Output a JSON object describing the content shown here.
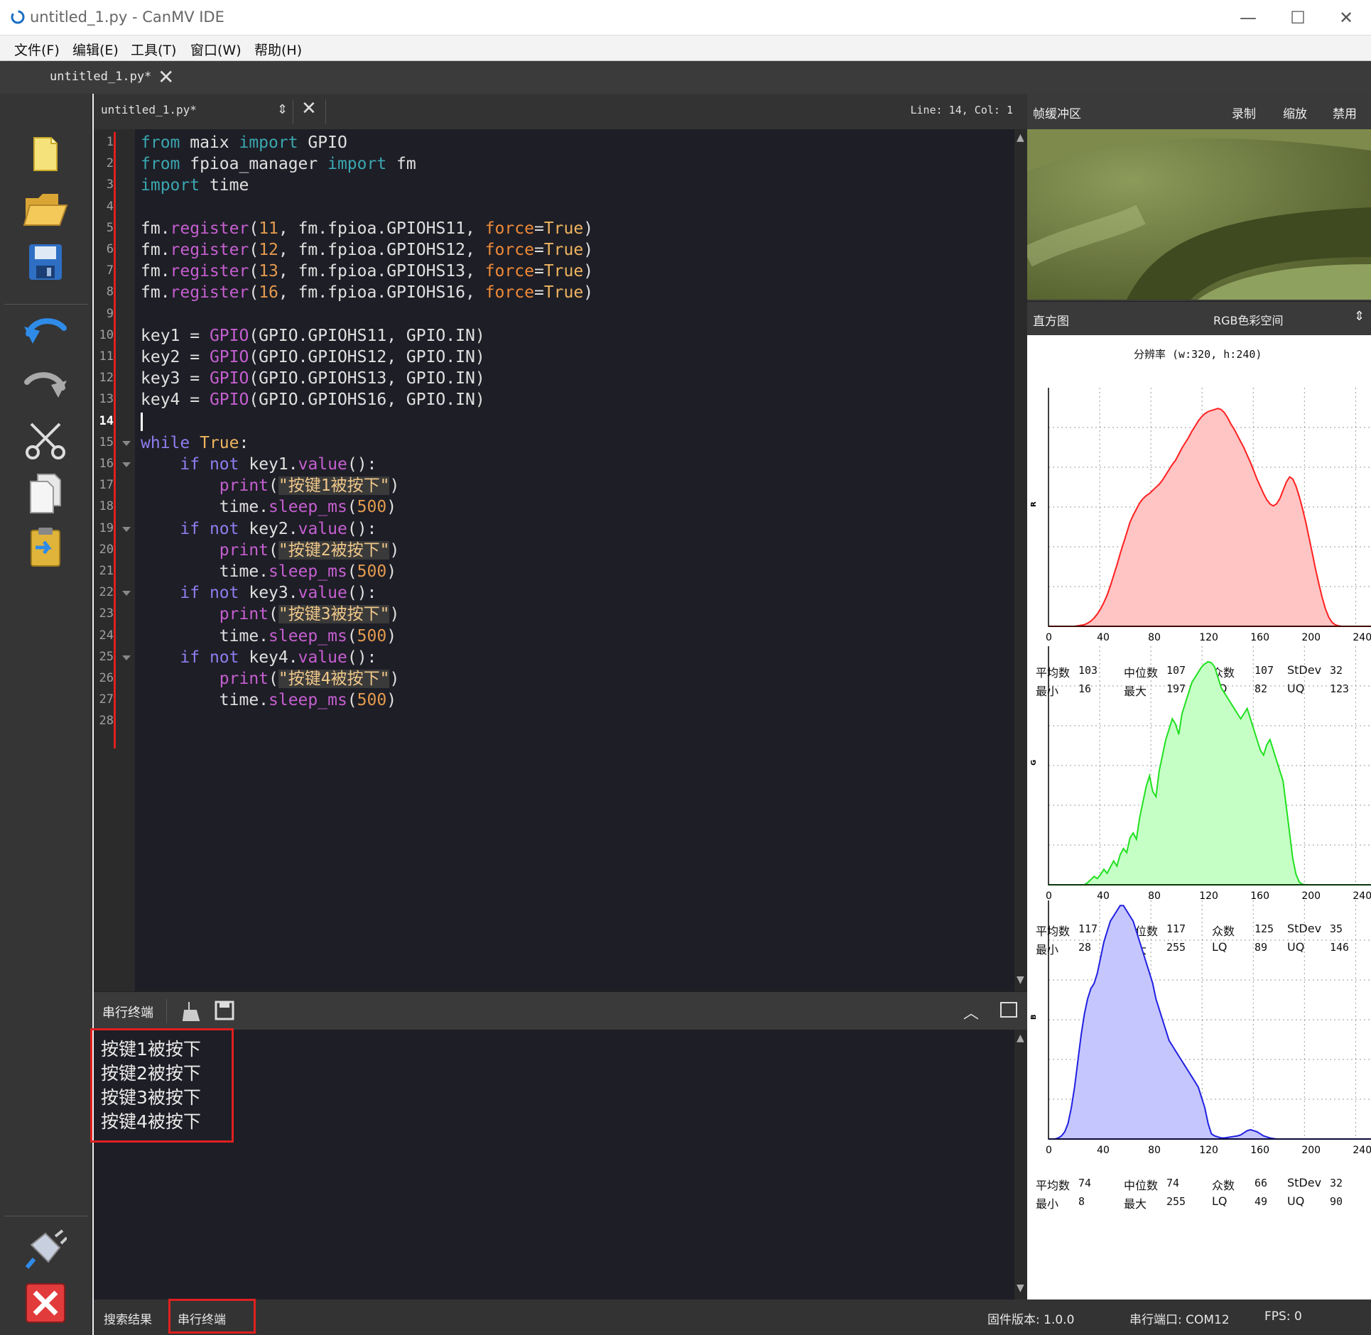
{
  "window": {
    "title": "untitled_1.py - CanMV IDE",
    "minimize": "—",
    "maximize": "☐",
    "close": "✕"
  },
  "menu": [
    "文件(F)",
    "编辑(E)",
    "工具(T)",
    "窗口(W)",
    "帮助(H)"
  ],
  "tab": {
    "label": "untitled_1.py*",
    "close": "✕"
  },
  "editor": {
    "file": "untitled_1.py*",
    "position": "Line: 14, Col: 1",
    "current_line": 14,
    "line_numbers": [
      "1",
      "2",
      "3",
      "4",
      "5",
      "6",
      "7",
      "8",
      "9",
      "10",
      "11",
      "12",
      "13",
      "14",
      "15",
      "16",
      "17",
      "18",
      "19",
      "20",
      "21",
      "22",
      "23",
      "24",
      "25",
      "26",
      "27",
      "28"
    ],
    "code": [
      "from maix import GPIO",
      "from fpioa_manager import fm",
      "import time",
      "",
      "fm.register(11, fm.fpioa.GPIOHS11, force=True)",
      "fm.register(12, fm.fpioa.GPIOHS12, force=True)",
      "fm.register(13, fm.fpioa.GPIOHS13, force=True)",
      "fm.register(16, fm.fpioa.GPIOHS16, force=True)",
      "",
      "key1 = GPIO(GPIO.GPIOHS11, GPIO.IN)",
      "key2 = GPIO(GPIO.GPIOHS12, GPIO.IN)",
      "key3 = GPIO(GPIO.GPIOHS13, GPIO.IN)",
      "key4 = GPIO(GPIO.GPIOHS16, GPIO.IN)",
      "",
      "while True:",
      "    if not key1.value():",
      "        print(\"按键1被按下\")",
      "        time.sleep_ms(500)",
      "    if not key2.value():",
      "        print(\"按键2被按下\")",
      "        time.sleep_ms(500)",
      "    if not key3.value():",
      "        print(\"按键3被按下\")",
      "        time.sleep_ms(500)",
      "    if not key4.value():",
      "        print(\"按键4被按下\")",
      "        time.sleep_ms(500)",
      ""
    ]
  },
  "terminal": {
    "title": "串行终端",
    "lines": [
      "按键1被按下",
      "按键2被按下",
      "按键3被按下",
      "按键4被按下"
    ]
  },
  "status": {
    "search_tab": "搜索结果",
    "terminal_tab": "串行终端",
    "firmware": "固件版本: 1.0.0",
    "port": "串行端口: COM12",
    "fps": "FPS: 0"
  },
  "framebuffer": {
    "title": "帧缓冲区",
    "record": "录制",
    "zoom": "缩放",
    "disable": "禁用"
  },
  "histogram": {
    "title": "直方图",
    "colorspace": "RGB色彩空间",
    "resolution": "分辨率 (w:320, h:240)",
    "x_ticks": [
      "0",
      "40",
      "80",
      "120",
      "160",
      "200",
      "240"
    ],
    "channels": [
      {
        "name": "R",
        "color": "#ff2020",
        "fill": "#ffc4c4",
        "values": [
          0,
          0,
          0,
          0,
          0,
          0,
          0,
          0,
          0,
          1,
          2,
          3,
          6,
          10,
          16,
          24,
          34,
          46,
          60,
          78,
          98,
          118,
          140,
          160,
          180,
          200,
          214,
          226,
          238,
          246,
          252,
          256,
          262,
          268,
          274,
          282,
          292,
          302,
          312,
          320,
          332,
          344,
          354,
          364,
          376,
          386,
          396,
          404,
          410,
          414,
          416,
          418,
          420,
          418,
          412,
          402,
          390,
          380,
          368,
          356,
          344,
          330,
          316,
          300,
          284,
          270,
          256,
          244,
          236,
          232,
          236,
          246,
          262,
          278,
          288,
          284,
          270,
          250,
          226,
          200,
          170,
          140,
          110,
          82,
          56,
          34,
          18,
          8,
          3,
          1,
          0,
          0,
          0,
          0,
          0,
          0,
          0,
          0,
          0,
          0
        ],
        "stats": {
          "mean": "103",
          "median": "107",
          "mode": "107",
          "stdev": "32",
          "min": "16",
          "max": "197",
          "lq": "82",
          "uq": "123"
        }
      },
      {
        "name": "G",
        "color": "#20e020",
        "fill": "#c6ffc6",
        "values": [
          0,
          0,
          0,
          0,
          0,
          0,
          0,
          0,
          0,
          0,
          0,
          0,
          4,
          10,
          16,
          12,
          20,
          30,
          22,
          34,
          46,
          36,
          58,
          70,
          62,
          90,
          100,
          88,
          130,
          160,
          190,
          210,
          180,
          170,
          220,
          250,
          280,
          300,
          320,
          310,
          290,
          330,
          350,
          370,
          390,
          400,
          410,
          420,
          426,
          430,
          428,
          420,
          400,
          380,
          370,
          360,
          350,
          340,
          330,
          320,
          330,
          340,
          320,
          300,
          280,
          260,
          250,
          270,
          280,
          260,
          240,
          220,
          200,
          150,
          100,
          50,
          20,
          5,
          1,
          0,
          0,
          0,
          0,
          0,
          0,
          0,
          0,
          0,
          0,
          0,
          0,
          0,
          0,
          0,
          0,
          0,
          0,
          0,
          0,
          0
        ],
        "stats": {
          "mean": "117",
          "median": "117",
          "mode": "125",
          "stdev": "35",
          "min": "28",
          "max": "255",
          "lq": "89",
          "uq": "146"
        }
      },
      {
        "name": "B",
        "color": "#2020e0",
        "fill": "#c6c6ff",
        "values": [
          0,
          0,
          0,
          2,
          6,
          14,
          30,
          60,
          100,
          150,
          200,
          240,
          270,
          290,
          300,
          320,
          350,
          380,
          400,
          420,
          430,
          440,
          450,
          450,
          440,
          430,
          420,
          400,
          380,
          360,
          340,
          320,
          300,
          270,
          250,
          230,
          210,
          190,
          180,
          170,
          160,
          150,
          140,
          130,
          120,
          110,
          100,
          80,
          60,
          30,
          10,
          6,
          4,
          2,
          2,
          3,
          4,
          5,
          6,
          8,
          12,
          16,
          18,
          16,
          14,
          10,
          6,
          4,
          2,
          1,
          0,
          0,
          0,
          0,
          0,
          0,
          0,
          0,
          0,
          0,
          0,
          0,
          0,
          0,
          0,
          0,
          0,
          0,
          0,
          0,
          0,
          0,
          0,
          0,
          0,
          0,
          0,
          0,
          0,
          0
        ],
        "stats": {
          "mean": "74",
          "median": "74",
          "mode": "66",
          "stdev": "32",
          "min": "8",
          "max": "255",
          "lq": "49",
          "uq": "90"
        }
      }
    ],
    "labels": {
      "mean": "平均数",
      "median": "中位数",
      "mode": "众数",
      "stdev": "StDev",
      "min": "最小",
      "max": "最大",
      "lq": "LQ",
      "uq": "UQ"
    }
  },
  "colors": {
    "editor_bg": "#1e1e26",
    "highlight_red": "#e02020"
  }
}
